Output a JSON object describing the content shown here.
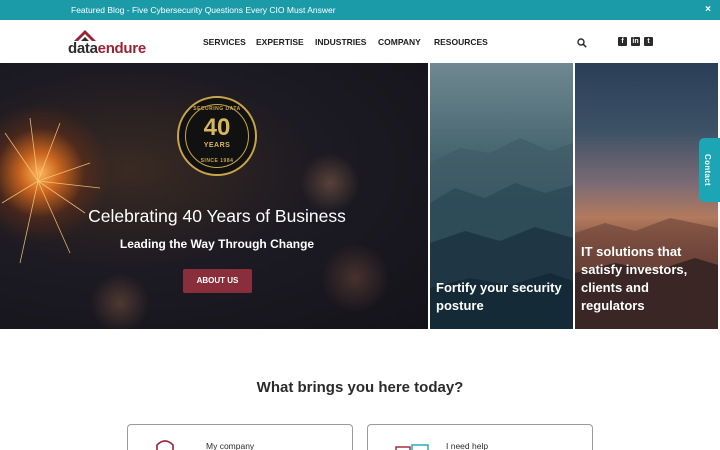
{
  "announcement": {
    "text": "Featured Blog -  Five Cybersecurity Questions Every CIO Must Answer",
    "close_label": "×"
  },
  "logo": {
    "part1": "data",
    "part2": "endure"
  },
  "nav": {
    "items": [
      "SERVICES",
      "EXPERTISE",
      "INDUSTRIES",
      "COMPANY",
      "RESOURCES"
    ]
  },
  "header_icons": [
    "search-icon",
    "facebook-icon",
    "linkedin-icon",
    "twitter-icon"
  ],
  "badge": {
    "top": "SECURING DATA",
    "number": "40",
    "years": "YEARS",
    "since": "SINCE 1984"
  },
  "hero": {
    "title": "Celebrating 40 Years of Business",
    "subtitle": "Leading the Way Through Change",
    "button": "ABOUT US"
  },
  "tiles": [
    {
      "text": "Fortify your security posture"
    },
    {
      "text": "IT solutions that satisfy investors, clients and regulators"
    }
  ],
  "contact_tab": "Contact",
  "section": {
    "question": "What brings you here today?",
    "cards": [
      {
        "label": "My company"
      },
      {
        "label": "I need help"
      }
    ]
  },
  "colors": {
    "topbar": "#1b9aa8",
    "brand_red": "#9b2335",
    "button": "#8a2e3b",
    "contact": "#1ba5b5",
    "badge_gold": "#c9a54a"
  }
}
